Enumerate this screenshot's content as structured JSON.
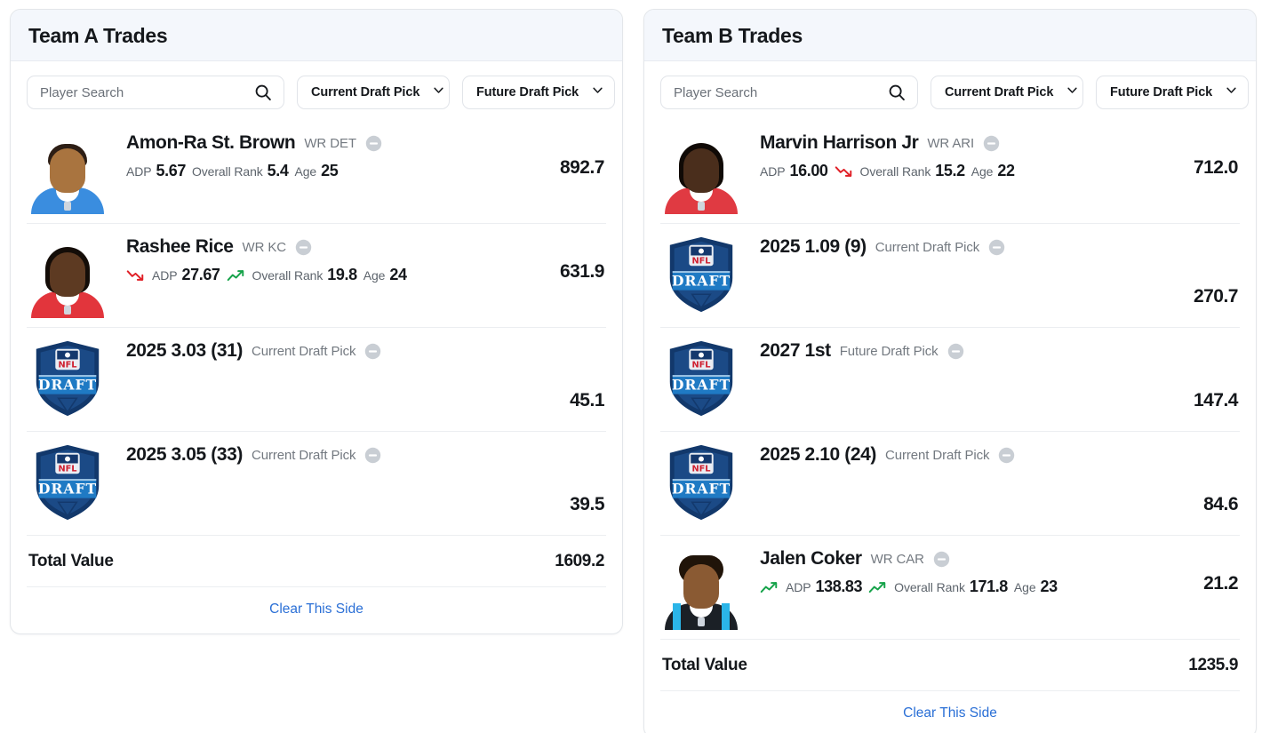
{
  "colors": {
    "accent_link": "#2a6fd6",
    "header_bg": "#f4f7fc",
    "trend_up": "#16a34a",
    "trend_down": "#e01f26",
    "remove_icon": "#c9ced4",
    "card_border": "#e3e6ea"
  },
  "panels": [
    {
      "id": "team-a",
      "title": "Team A Trades",
      "search": {
        "placeholder": "Player Search",
        "value": ""
      },
      "current_pick_label": "Current Draft Pick",
      "future_pick_label": "Future Draft Pick",
      "rows": [
        {
          "kind": "player",
          "name": "Amon-Ra St. Brown",
          "meta": "WR DET",
          "value": "892.7",
          "stats": [
            {
              "label": "ADP",
              "value": "5.67",
              "trend": "none"
            },
            {
              "label": "Overall Rank",
              "value": "5.4",
              "trend": "none"
            },
            {
              "label": "Age",
              "value": "25",
              "trend": "none"
            }
          ],
          "art": {
            "type": "headshot",
            "jersey": "#3a8ddf",
            "skin": "#a9743f",
            "hair": "#2d1e15",
            "hairstyle": "short"
          }
        },
        {
          "kind": "player",
          "name": "Rashee Rice",
          "meta": "WR KC",
          "value": "631.9",
          "stats": [
            {
              "label": "ADP",
              "value": "27.67",
              "trend": "down"
            },
            {
              "label": "Overall Rank",
              "value": "19.8",
              "trend": "up"
            },
            {
              "label": "Age",
              "value": "24",
              "trend": "none"
            }
          ],
          "art": {
            "type": "headshot",
            "jersey": "#e2353c",
            "skin": "#5d3a22",
            "hair": "#140d08",
            "hairstyle": "long"
          }
        },
        {
          "kind": "pick",
          "name": "2025 3.03 (31)",
          "meta": "Current Draft Pick",
          "value": "45.1",
          "stats": [],
          "art": {
            "type": "draft-shield"
          }
        },
        {
          "kind": "pick",
          "name": "2025 3.05 (33)",
          "meta": "Current Draft Pick",
          "value": "39.5",
          "stats": [],
          "art": {
            "type": "draft-shield"
          }
        }
      ],
      "total_label": "Total Value",
      "total_value": "1609.2",
      "clear_label": "Clear This Side"
    },
    {
      "id": "team-b",
      "title": "Team B Trades",
      "search": {
        "placeholder": "Player Search",
        "value": ""
      },
      "current_pick_label": "Current Draft Pick",
      "future_pick_label": "Future Draft Pick",
      "rows": [
        {
          "kind": "player",
          "name": "Marvin Harrison Jr",
          "meta": "WR ARI",
          "value": "712.0",
          "stats": [
            {
              "label": "ADP",
              "value": "16.00",
              "trend": "none"
            },
            {
              "label": "Overall Rank",
              "value": "15.2",
              "trend": "down"
            },
            {
              "label": "Age",
              "value": "22",
              "trend": "none"
            }
          ],
          "art": {
            "type": "headshot",
            "jersey": "#e03a42",
            "skin": "#4a2e1c",
            "hair": "#100a06",
            "hairstyle": "long"
          }
        },
        {
          "kind": "pick",
          "name": "2025 1.09 (9)",
          "meta": "Current Draft Pick",
          "value": "270.7",
          "stats": [],
          "art": {
            "type": "draft-shield"
          }
        },
        {
          "kind": "pick",
          "name": "2027 1st",
          "meta": "Future Draft Pick",
          "value": "147.4",
          "stats": [],
          "art": {
            "type": "draft-shield"
          }
        },
        {
          "kind": "pick",
          "name": "2025 2.10 (24)",
          "meta": "Current Draft Pick",
          "value": "84.6",
          "stats": [],
          "art": {
            "type": "draft-shield"
          }
        },
        {
          "kind": "player",
          "name": "Jalen Coker",
          "meta": "WR CAR",
          "value": "21.2",
          "stats": [
            {
              "label": "ADP",
              "value": "138.83",
              "trend": "up"
            },
            {
              "label": "Overall Rank",
              "value": "171.8",
              "trend": "up"
            },
            {
              "label": "Age",
              "value": "23",
              "trend": "none"
            }
          ],
          "art": {
            "type": "headshot",
            "jersey": "#1b2026",
            "accent": "#2bb5e8",
            "skin": "#8a5a33",
            "hair": "#201409",
            "hairstyle": "afro"
          }
        }
      ],
      "total_label": "Total Value",
      "total_value": "1235.9",
      "clear_label": "Clear This Side"
    }
  ],
  "icons": {
    "search": "search-icon",
    "chevron": "chevron-down-icon",
    "remove": "remove-circle-icon",
    "trend_up": "trend-up-icon",
    "trend_down": "trend-down-icon",
    "draft_shield": "nfl-draft-shield-icon"
  }
}
